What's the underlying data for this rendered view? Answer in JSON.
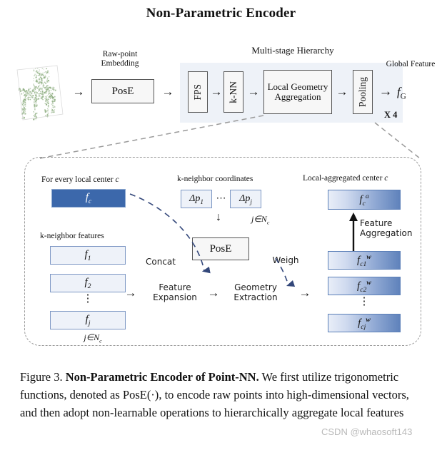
{
  "figure": {
    "title": "Non-Parametric Encoder"
  },
  "pipeline": {
    "raw_point_embedding_label": "Raw-point Embedding",
    "multi_stage_label": "Multi-stage Hierarchy",
    "global_feature_label": "Global Feature",
    "pose_box": "PosE",
    "fps_box": "FPS",
    "knn_box": "k-NN",
    "local_geometry_aggregation_box": "Local Geometry Aggregation",
    "pooling_box": "Pooling",
    "global_feature_symbol": "fG",
    "repeat_label": "X 4",
    "arrow": "→",
    "panel_color": "#eef2f8",
    "point_cloud_color": "#86a878"
  },
  "detail": {
    "center_label": "For every local center c",
    "kneighbor_features_label": "k-neighbor features",
    "kneighbor_coordinates_label": "k-neighbor coordinates",
    "local_aggregated_label": "Local-aggregated center c",
    "center_feature": "fc",
    "neighbor_features": [
      "f1",
      "f2",
      "fj"
    ],
    "vertical_dots": "⋮",
    "neighbor_set_label": "j∈Nc",
    "delta_first": "Δp1",
    "delta_last": "Δpj",
    "horizontal_dots": "⋯",
    "down_arrow": "↓",
    "pose_box": "PosE",
    "concat_label": "Concat",
    "weigh_label": "Weigh",
    "feature_expansion_label": "Feature Expansion",
    "geometry_extraction_label": "Geometry Extraction",
    "feature_aggregation_label": "Feature Aggregation",
    "aggregated_feature": "fca",
    "weighted_features": [
      "fc1w",
      "fc2w",
      "fcjw"
    ],
    "arrow": "→",
    "accent_blue": "#3c68ab",
    "border_blue": "#7d97c4",
    "dashed_gray": "#9a9a9a"
  },
  "caption": {
    "figure_number": "Figure 3.",
    "bold_title": "Non-Parametric Encoder of Point-NN.",
    "body_part1": " We first utilize trigonometric functions, denoted as ",
    "pose_inline": "PosE(·)",
    "body_part2": ", to encode raw points into high-dimensional vectors, and then adopt non-learnable operations to hierarchically aggregate local features",
    "watermark": "CSDN @whaosoft143"
  }
}
